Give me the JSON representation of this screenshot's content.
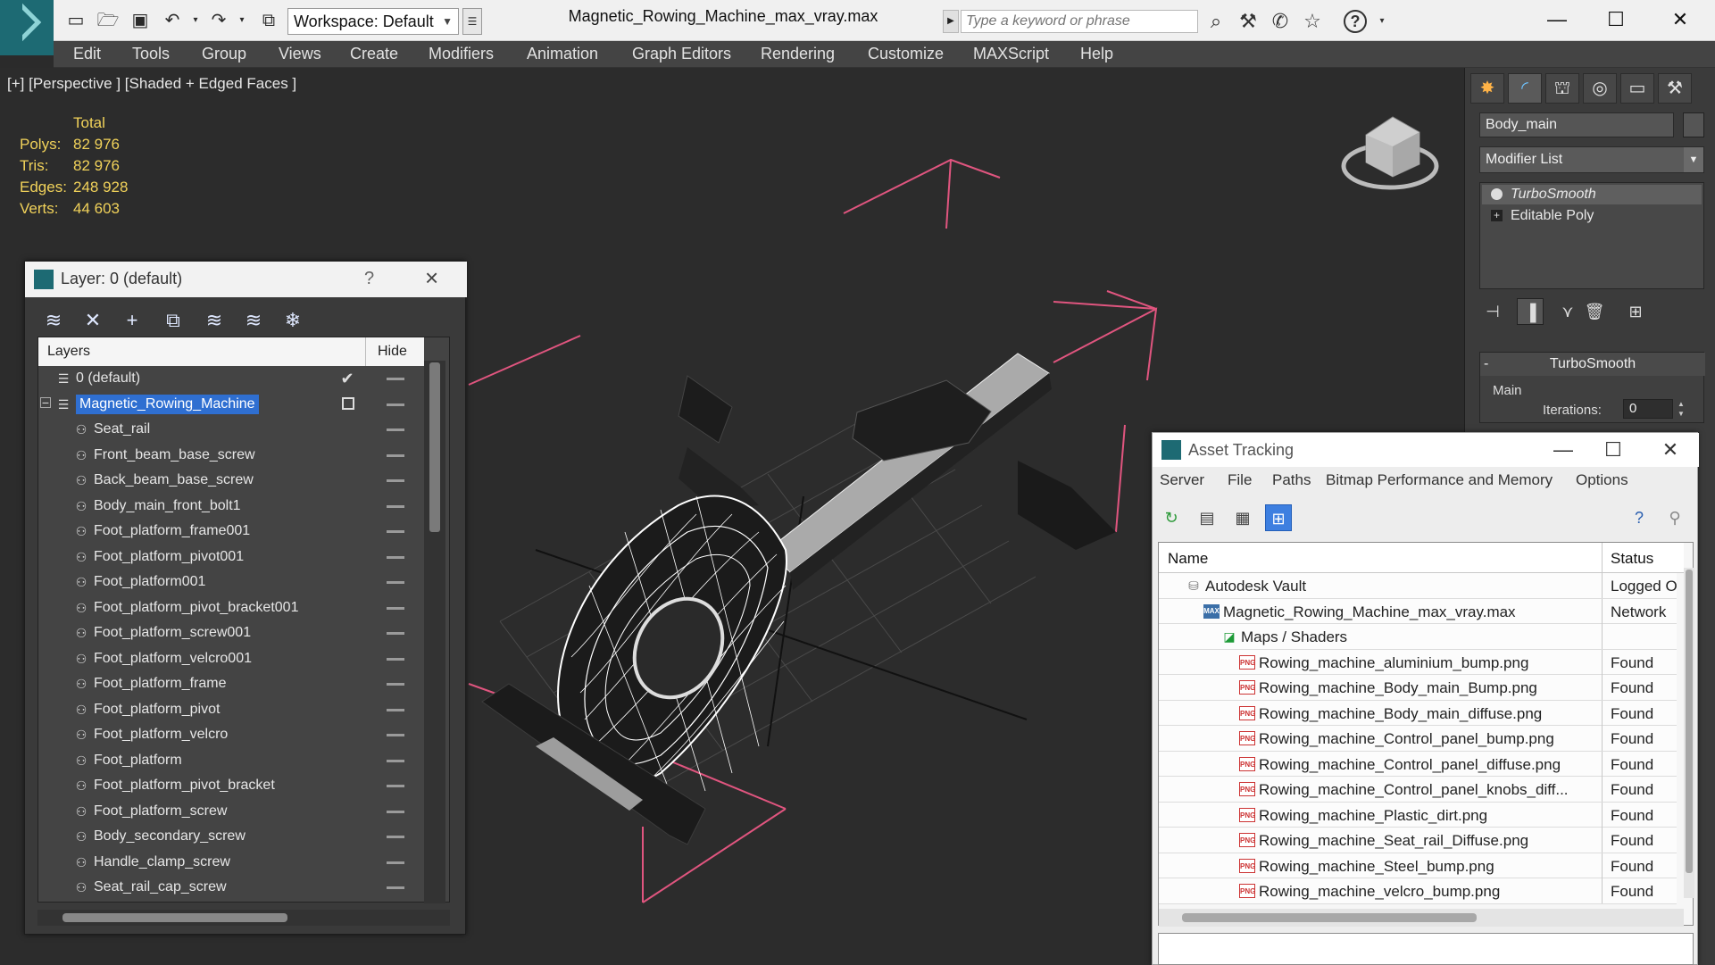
{
  "window": {
    "title": "Magnetic_Rowing_Machine_max_vray.max",
    "workspace": "Workspace: Default",
    "search_placeholder": "Type a keyword or phrase",
    "help_label": "?"
  },
  "menu": [
    "Edit",
    "Tools",
    "Group",
    "Views",
    "Create",
    "Modifiers",
    "Animation",
    "Graph Editors",
    "Rendering",
    "Customize",
    "MAXScript",
    "Help"
  ],
  "viewport": {
    "label": "[+] [Perspective ] [Shaded + Edged Faces ]",
    "stats_header": "Total",
    "stats": [
      {
        "label": "Polys:",
        "value": "82 976"
      },
      {
        "label": "Tris:",
        "value": "82 976"
      },
      {
        "label": "Edges:",
        "value": "248 928"
      },
      {
        "label": "Verts:",
        "value": "44 603"
      }
    ]
  },
  "command_panel": {
    "object_name": "Body_main",
    "modifier_list": "Modifier List",
    "stack": [
      "TurboSmooth",
      "Editable Poly"
    ],
    "rollout_title": "TurboSmooth",
    "rollout_collapse": "-",
    "main_label": "Main",
    "iterations_label": "Iterations:",
    "iterations_value": "0"
  },
  "layer_dialog": {
    "title": "Layer: 0 (default)",
    "help": "?",
    "col_layers": "Layers",
    "col_hide": "Hide",
    "rows": [
      {
        "name": "0 (default)",
        "level": 0,
        "active": true
      },
      {
        "name": "Magnetic_Rowing_Machine",
        "level": 0,
        "selected": true,
        "collapse": "−"
      },
      {
        "name": "Seat_rail",
        "level": 1
      },
      {
        "name": "Front_beam_base_screw",
        "level": 1
      },
      {
        "name": "Back_beam_base_screw",
        "level": 1
      },
      {
        "name": "Body_main_front_bolt1",
        "level": 1
      },
      {
        "name": "Foot_platform_frame001",
        "level": 1
      },
      {
        "name": "Foot_platform_pivot001",
        "level": 1
      },
      {
        "name": "Foot_platform001",
        "level": 1
      },
      {
        "name": "Foot_platform_pivot_bracket001",
        "level": 1
      },
      {
        "name": "Foot_platform_screw001",
        "level": 1
      },
      {
        "name": "Foot_platform_velcro001",
        "level": 1
      },
      {
        "name": "Foot_platform_frame",
        "level": 1
      },
      {
        "name": "Foot_platform_pivot",
        "level": 1
      },
      {
        "name": "Foot_platform_velcro",
        "level": 1
      },
      {
        "name": "Foot_platform",
        "level": 1
      },
      {
        "name": "Foot_platform_pivot_bracket",
        "level": 1
      },
      {
        "name": "Foot_platform_screw",
        "level": 1
      },
      {
        "name": "Body_secondary_screw",
        "level": 1
      },
      {
        "name": "Handle_clamp_screw",
        "level": 1
      },
      {
        "name": "Seat_rail_cap_screw",
        "level": 1
      }
    ]
  },
  "asset_dialog": {
    "title": "Asset Tracking",
    "menu": [
      "Server",
      "File",
      "Paths",
      "Bitmap Performance and Memory",
      "Options"
    ],
    "col_name": "Name",
    "col_status": "Status",
    "rows": [
      {
        "name": "Autodesk Vault",
        "status": "Logged Out",
        "icon": "vault",
        "level": 1
      },
      {
        "name": "Magnetic_Rowing_Machine_max_vray.max",
        "status": "Network",
        "icon": "max",
        "level": 2
      },
      {
        "name": "Maps / Shaders",
        "status": "",
        "icon": "maps",
        "level": 3
      },
      {
        "name": "Rowing_machine_aluminium_bump.png",
        "status": "Found",
        "icon": "png",
        "level": 4
      },
      {
        "name": "Rowing_machine_Body_main_Bump.png",
        "status": "Found",
        "icon": "png",
        "level": 4
      },
      {
        "name": "Rowing_machine_Body_main_diffuse.png",
        "status": "Found",
        "icon": "png",
        "level": 4
      },
      {
        "name": "Rowing_machine_Control_panel_bump.png",
        "status": "Found",
        "icon": "png",
        "level": 4
      },
      {
        "name": "Rowing_machine_Control_panel_diffuse.png",
        "status": "Found",
        "icon": "png",
        "level": 4
      },
      {
        "name": "Rowing_machine_Control_panel_knobs_diff...",
        "status": "Found",
        "icon": "png",
        "level": 4
      },
      {
        "name": "Rowing_machine_Plastic_dirt.png",
        "status": "Found",
        "icon": "png",
        "level": 4
      },
      {
        "name": "Rowing_machine_Seat_rail_Diffuse.png",
        "status": "Found",
        "icon": "png",
        "level": 4
      },
      {
        "name": "Rowing_machine_Steel_bump.png",
        "status": "Found",
        "icon": "png",
        "level": 4
      },
      {
        "name": "Rowing_machine_velcro_bump.png",
        "status": "Found",
        "icon": "png",
        "level": 4
      }
    ]
  },
  "colors": {
    "accent": "#2f6fd1",
    "stats": "#f1d25a",
    "selection_box": "#e0557f",
    "wire": "#ffffff"
  }
}
